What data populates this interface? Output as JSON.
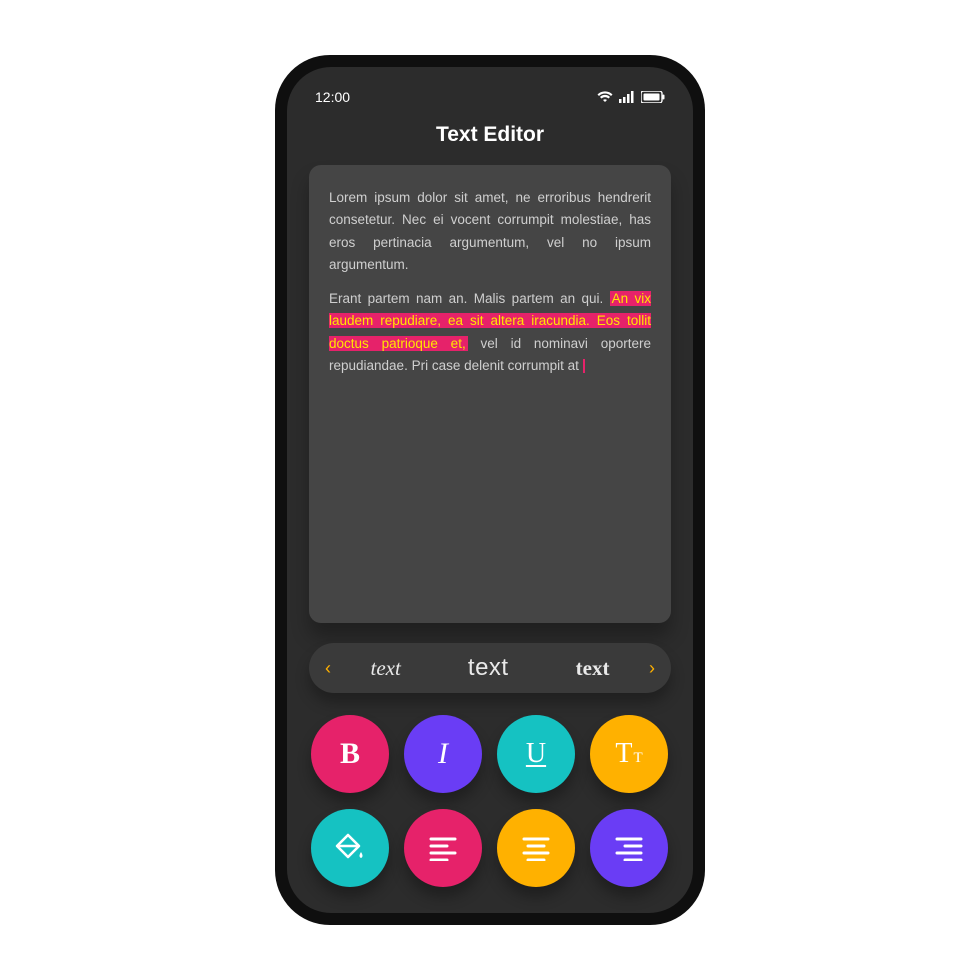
{
  "status": {
    "time": "12:00"
  },
  "app": {
    "title": "Text Editor"
  },
  "editor": {
    "para1": "Lorem ipsum dolor sit amet, ne erroribus hendrerit consetetur. Nec ei vocent corrumpit molestiae, has eros pertinacia argumentum, vel no ipsum argumentum.",
    "para2_before": "Erant partem nam an. Malis partem an qui. ",
    "para2_highlight": "An vix laudem repudiare, ea sit altera iracundia. Eos tollit doctus patrioque et,",
    "para2_after": " vel id nominavi oportere repudiandae. Pri case delenit corrumpit at "
  },
  "fontPicker": {
    "opt1": "text",
    "opt2": "text",
    "opt3": "text"
  },
  "tools": {
    "bold": "B",
    "italic": "I",
    "underline": "U",
    "sizeBig": "T",
    "sizeSmall": "T"
  },
  "colors": {
    "pink": "#e6226a",
    "purple": "#6a3df5",
    "teal": "#15c2c2",
    "yellow": "#ffb100"
  }
}
